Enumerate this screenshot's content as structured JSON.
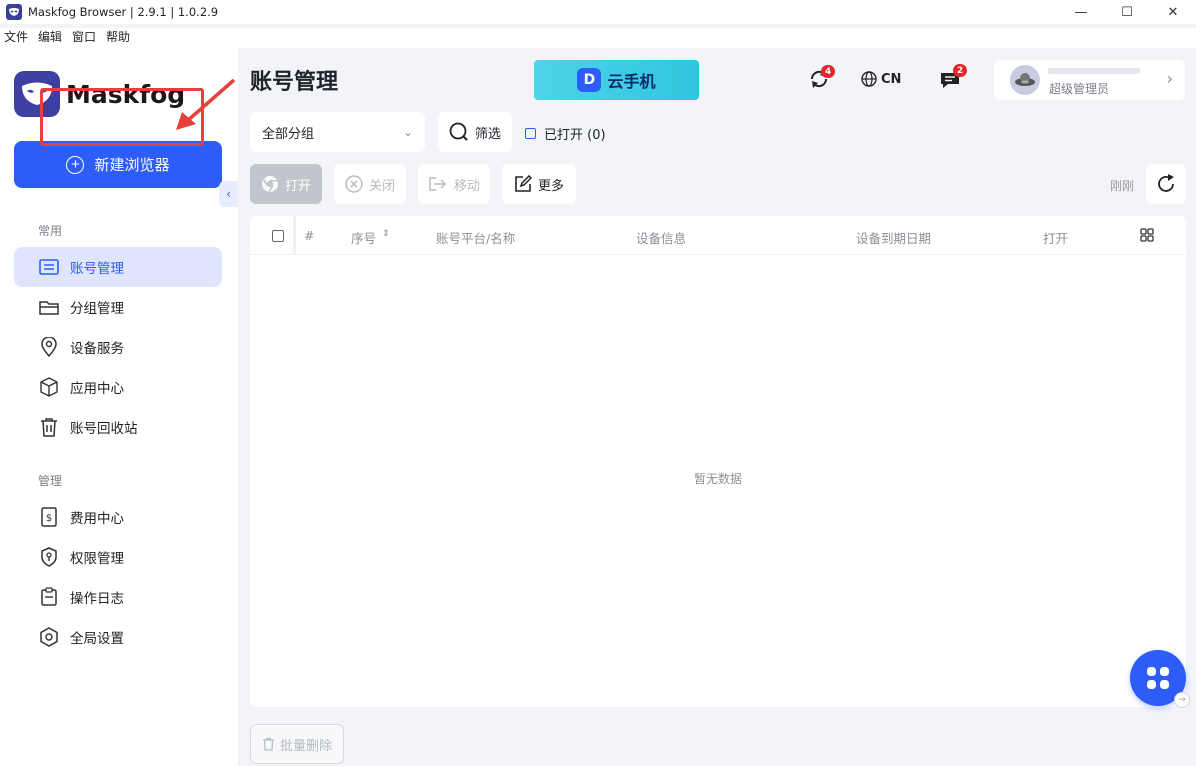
{
  "window": {
    "title": "Maskfog Browser | 2.9.1 | 1.0.2.9",
    "controls": [
      "—",
      "☐",
      "✕"
    ]
  },
  "menu": [
    "文件",
    "编辑",
    "窗口",
    "帮助"
  ],
  "brand": {
    "name": "Maskfog",
    "accent": "#2d5cf6",
    "logo_bg": "#3d3fa3"
  },
  "sidebar": {
    "new_button": "新建浏览器",
    "sections": {
      "common": "常用",
      "manage": "管理"
    },
    "common_items": [
      {
        "label": "账号管理",
        "icon": "account-list-icon",
        "active": true
      },
      {
        "label": "分组管理",
        "icon": "folder-icon"
      },
      {
        "label": "设备服务",
        "icon": "location-pin-icon"
      },
      {
        "label": "应用中心",
        "icon": "cube-icon"
      },
      {
        "label": "账号回收站",
        "icon": "trash-icon"
      }
    ],
    "manage_items": [
      {
        "label": "费用中心",
        "icon": "billing-icon"
      },
      {
        "label": "权限管理",
        "icon": "shield-key-icon"
      },
      {
        "label": "操作日志",
        "icon": "clipboard-icon"
      },
      {
        "label": "全局设置",
        "icon": "settings-icon"
      }
    ]
  },
  "header": {
    "title": "账号管理",
    "banner": "云手机",
    "sync_badge": "4",
    "language": "CN",
    "message_badge": "2",
    "user_role": "超级管理员"
  },
  "toolbar": {
    "group_select": "全部分组",
    "filter": "筛选",
    "opened_filter": "已打开 (0)",
    "open": "打开",
    "close": "关闭",
    "move": "移动",
    "more": "更多",
    "refresh_time": "刚刚"
  },
  "table": {
    "columns": [
      "#",
      "序号",
      "账号平台/名称",
      "设备信息",
      "设备到期日期",
      "打开"
    ],
    "empty_text": "暂无数据"
  },
  "footer": {
    "bulk_delete": "批量删除"
  }
}
